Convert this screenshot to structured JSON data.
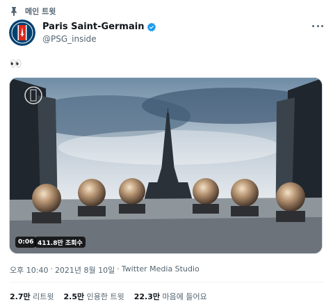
{
  "pinned": {
    "label": "메인 트윗"
  },
  "author": {
    "display_name": "Paris Saint-Germain",
    "handle": "@PSG_inside",
    "avatar_text": "PARIS SAINT-GERMAIN"
  },
  "tweet": {
    "text": "👀"
  },
  "media": {
    "duration": "0:06",
    "views": "411.8만 조회수"
  },
  "meta": {
    "time": "오후 10:40",
    "date": "2021년 8월 10일",
    "separator": "·",
    "source": "Twitter Media Studio"
  },
  "stats": {
    "retweets_count": "2.7만",
    "retweets_label": "리트윗",
    "quotes_count": "2.5만",
    "quotes_label": "인용한 트윗",
    "likes_count": "22.3만",
    "likes_label": "마음에 들어요"
  },
  "colors": {
    "verified": "#1d9bf0",
    "psg_navy": "#004170",
    "psg_red": "#da291c"
  }
}
